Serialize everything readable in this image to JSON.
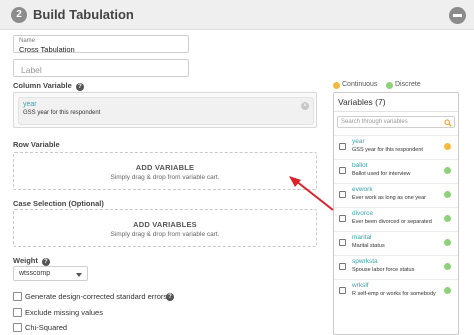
{
  "header": {
    "step_number": "2",
    "title": "Build Tabulation"
  },
  "name_field": {
    "label": "Name",
    "value": "Cross Tabulation"
  },
  "label_field": {
    "placeholder": "Label"
  },
  "column_variable": {
    "label": "Column Variable",
    "help_icon": "?",
    "chip": {
      "name": "year",
      "description": "GSS year for this respondent",
      "remove_icon": "×"
    }
  },
  "row_variable": {
    "label": "Row Variable",
    "drop_title": "ADD VARIABLE",
    "drop_hint": "Simply drag & drop from variable cart."
  },
  "case_selection": {
    "label": "Case Selection (Optional)",
    "drop_title": "ADD VARIABLES",
    "drop_hint": "Simply drag & drop from variable cart."
  },
  "weight": {
    "label": "Weight",
    "help_icon": "?",
    "selected": "wtsscomp"
  },
  "options": [
    {
      "label": "Generate design-corrected standard errors",
      "checked": false,
      "help": "?"
    },
    {
      "label": "Exclude missing values",
      "checked": false,
      "help": ""
    },
    {
      "label": "Chi-Squared",
      "checked": false,
      "help": ""
    }
  ],
  "legend": {
    "continuous": {
      "label": "Continuous",
      "color": "#f5b941"
    },
    "discrete": {
      "label": "Discrete",
      "color": "#8fd17a"
    }
  },
  "variables_panel": {
    "title": "Variables (7)",
    "search_placeholder": "Search through variables",
    "search_icon_color": "#f0a020",
    "items": [
      {
        "name": "year",
        "description": "GSS year for this respondent",
        "type": "continuous"
      },
      {
        "name": "ballot",
        "description": "Ballot used for interview",
        "type": "discrete"
      },
      {
        "name": "evwork",
        "description": "Ever work as long as one year",
        "type": "discrete"
      },
      {
        "name": "divorce",
        "description": "Ever been divorced or separated",
        "type": "discrete"
      },
      {
        "name": "marital",
        "description": "Marital status",
        "type": "discrete"
      },
      {
        "name": "spwrksta",
        "description": "Spouse labor force status",
        "type": "discrete"
      },
      {
        "name": "wrkslf",
        "description": "R self-emp or works for somebody",
        "type": "discrete"
      }
    ]
  },
  "annotation_color": "#d9232a"
}
